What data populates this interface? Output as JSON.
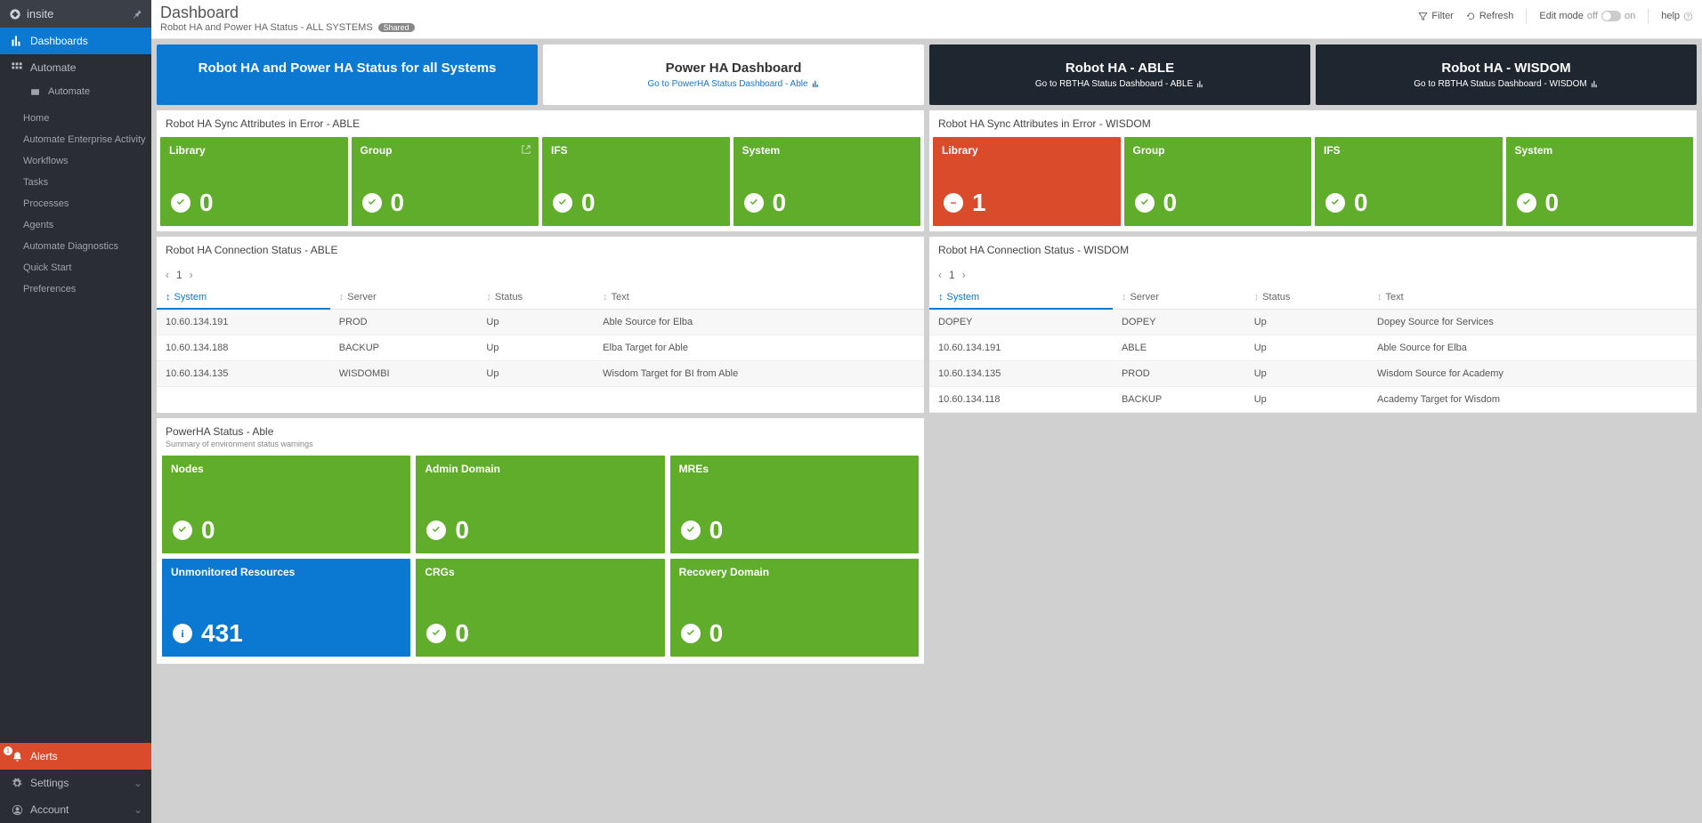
{
  "brand": "insite",
  "sidebar": {
    "dashboards": "Dashboards",
    "automate": "Automate",
    "automate_sub": "Automate",
    "menu": [
      "Home",
      "Automate Enterprise Activity",
      "Workflows",
      "Tasks",
      "Processes",
      "Agents",
      "Automate Diagnostics",
      "Quick Start",
      "Preferences"
    ],
    "alerts": "Alerts",
    "settings": "Settings",
    "account": "Account"
  },
  "topbar": {
    "title": "Dashboard",
    "subtitle": "Robot HA and Power HA Status - ALL SYSTEMS",
    "shared": "Shared",
    "filter": "Filter",
    "refresh": "Refresh",
    "editmode": "Edit mode",
    "off": "off",
    "on": "on",
    "help": "help"
  },
  "tabs": [
    {
      "title": "Robot HA and Power HA Status for all Systems",
      "sub": ""
    },
    {
      "title": "Power HA Dashboard",
      "sub": "Go to PowerHA Status Dashboard - Able"
    },
    {
      "title": "Robot HA - ABLE",
      "sub": "Go to RBTHA Status Dashboard - ABLE"
    },
    {
      "title": "Robot HA - WISDOM",
      "sub": "Go to RBTHA Status Dashboard - WISDOM"
    }
  ],
  "sync_able": {
    "title": "Robot HA Sync Attributes in Error - ABLE",
    "tiles": [
      {
        "label": "Library",
        "value": "0",
        "icon": "check"
      },
      {
        "label": "Group",
        "value": "0",
        "icon": "check",
        "popout": true
      },
      {
        "label": "IFS",
        "value": "0",
        "icon": "check"
      },
      {
        "label": "System",
        "value": "0",
        "icon": "check"
      }
    ]
  },
  "sync_wisdom": {
    "title": "Robot HA Sync Attributes in Error - WISDOM",
    "tiles": [
      {
        "label": "Library",
        "value": "1",
        "icon": "minus",
        "red": true
      },
      {
        "label": "Group",
        "value": "0",
        "icon": "check"
      },
      {
        "label": "IFS",
        "value": "0",
        "icon": "check"
      },
      {
        "label": "System",
        "value": "0",
        "icon": "check"
      }
    ]
  },
  "conn_able": {
    "title": "Robot HA Connection Status - ABLE",
    "page": "1",
    "cols": [
      "System",
      "Server",
      "Status",
      "Text"
    ],
    "rows": [
      [
        "10.60.134.191",
        "PROD",
        "Up",
        "Able Source for Elba"
      ],
      [
        "10.60.134.188",
        "BACKUP",
        "Up",
        "Elba Target for Able"
      ],
      [
        "10.60.134.135",
        "WISDOMBI",
        "Up",
        "Wisdom Target for BI from Able"
      ]
    ]
  },
  "conn_wisdom": {
    "title": "Robot HA Connection Status - WISDOM",
    "page": "1",
    "cols": [
      "System",
      "Server",
      "Status",
      "Text"
    ],
    "rows": [
      [
        "DOPEY",
        "DOPEY",
        "Up",
        "Dopey Source for Services"
      ],
      [
        "10.60.134.191",
        "ABLE",
        "Up",
        "Able Source for Elba"
      ],
      [
        "10.60.134.135",
        "PROD",
        "Up",
        "Wisdom Source for Academy"
      ],
      [
        "10.60.134.118",
        "BACKUP",
        "Up",
        "Academy Target for Wisdom"
      ]
    ]
  },
  "powerha": {
    "title": "PowerHA Status - Able",
    "sub": "Summary of environment status warnings",
    "tiles": [
      {
        "label": "Nodes",
        "value": "0",
        "icon": "check"
      },
      {
        "label": "Admin Domain",
        "value": "0",
        "icon": "check"
      },
      {
        "label": "MREs",
        "value": "0",
        "icon": "check"
      },
      {
        "label": "Unmonitored Resources",
        "value": "431",
        "icon": "info",
        "blue": true
      },
      {
        "label": "CRGs",
        "value": "0",
        "icon": "check"
      },
      {
        "label": "Recovery Domain",
        "value": "0",
        "icon": "check"
      }
    ]
  }
}
